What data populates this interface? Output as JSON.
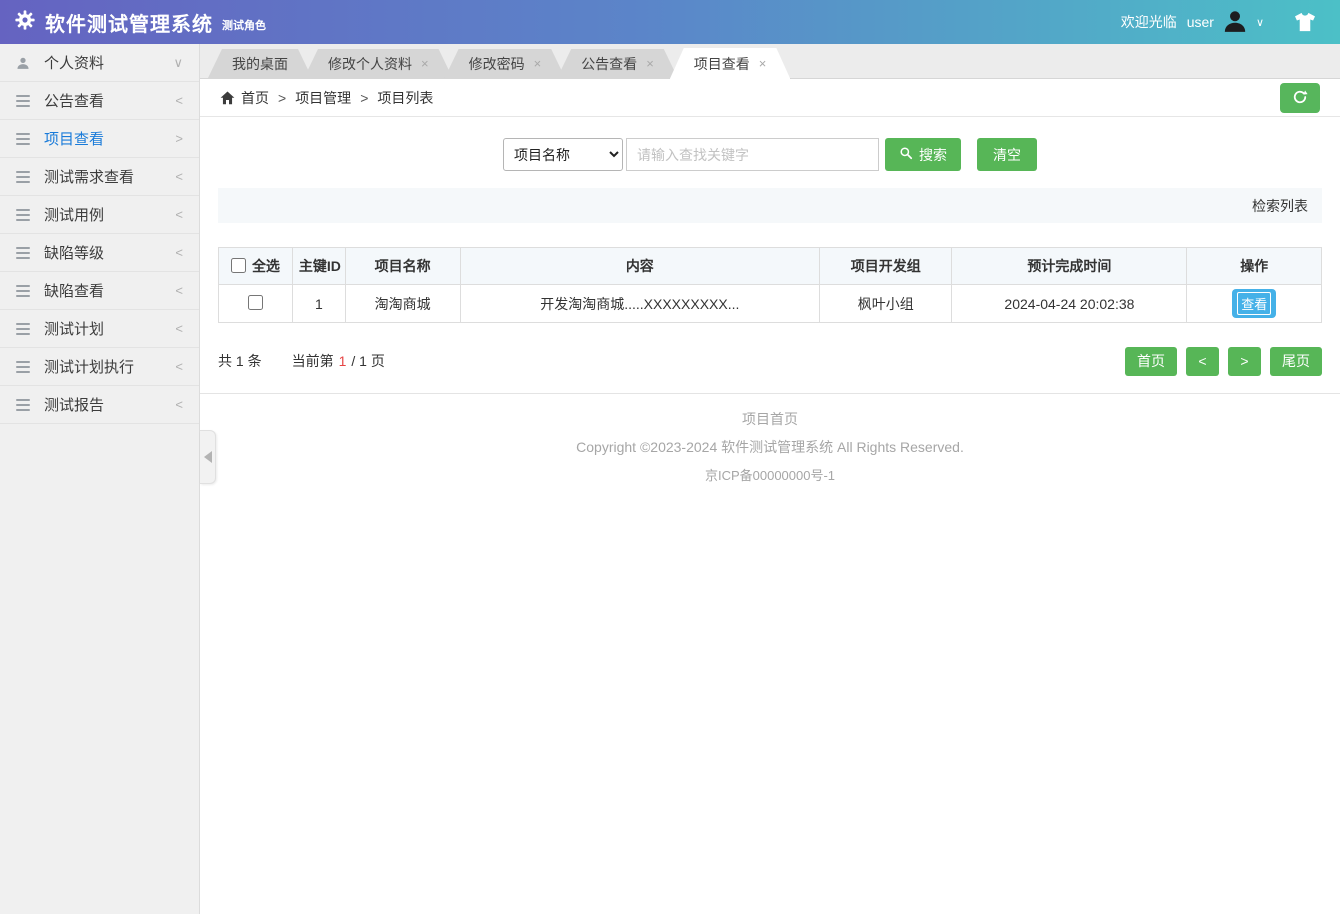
{
  "header": {
    "title": "软件测试管理系统",
    "subtitle": "测试角色",
    "welcome": "欢迎光临",
    "username": "user"
  },
  "icons": {
    "close": "×",
    "chevron_down": "∨",
    "chevron_left": "<",
    "chevron_right": ">"
  },
  "colors": {
    "header_gradient_left": "#6563c1",
    "header_gradient_right": "#4cc0c7",
    "accent_green": "#57b657",
    "action_blue": "#45b1e8",
    "active_menu_blue": "#1a7bd9",
    "page_number_red": "#e64545"
  },
  "sidebar": {
    "items": [
      {
        "name": "profile",
        "label": "个人资料",
        "icon": "user-icon",
        "arrow": "down",
        "active": false
      },
      {
        "name": "announcements",
        "label": "公告查看",
        "icon": "menu-icon",
        "arrow": "left",
        "active": false
      },
      {
        "name": "projects",
        "label": "项目查看",
        "icon": "menu-icon",
        "arrow": "right",
        "active": true
      },
      {
        "name": "test-requirements",
        "label": "测试需求查看",
        "icon": "menu-icon",
        "arrow": "left",
        "active": false
      },
      {
        "name": "test-cases",
        "label": "测试用例",
        "icon": "menu-icon",
        "arrow": "left",
        "active": false
      },
      {
        "name": "defect-levels",
        "label": "缺陷等级",
        "icon": "menu-icon",
        "arrow": "left",
        "active": false
      },
      {
        "name": "defects",
        "label": "缺陷查看",
        "icon": "menu-icon",
        "arrow": "left",
        "active": false
      },
      {
        "name": "test-plans",
        "label": "测试计划",
        "icon": "menu-icon",
        "arrow": "left",
        "active": false
      },
      {
        "name": "test-plan-execution",
        "label": "测试计划执行",
        "icon": "menu-icon",
        "arrow": "left",
        "active": false
      },
      {
        "name": "test-reports",
        "label": "测试报告",
        "icon": "menu-icon",
        "arrow": "left",
        "active": false
      }
    ]
  },
  "tabs": [
    {
      "name": "desktop",
      "label": "我的桌面",
      "closable": false,
      "active": false
    },
    {
      "name": "edit-profile",
      "label": "修改个人资料",
      "closable": true,
      "active": false
    },
    {
      "name": "change-password",
      "label": "修改密码",
      "closable": true,
      "active": false
    },
    {
      "name": "announcements",
      "label": "公告查看",
      "closable": true,
      "active": false
    },
    {
      "name": "projects",
      "label": "项目查看",
      "closable": true,
      "active": true
    }
  ],
  "breadcrumb": {
    "separator": ">",
    "items": [
      "首页",
      "项目管理",
      "项目列表"
    ]
  },
  "search": {
    "field_selected": "项目名称",
    "placeholder": "请输入查找关键字",
    "search_label": "搜索",
    "clear_label": "清空"
  },
  "list_bar": {
    "label": "检索列表"
  },
  "table": {
    "headers": [
      "全选",
      "主键ID",
      "项目名称",
      "内容",
      "项目开发组",
      "预计完成时间",
      "操作"
    ],
    "rows": [
      {
        "id": "1",
        "name": "淘淘商城",
        "content": "开发淘淘商城.....XXXXXXXXX...",
        "group": "枫叶小组",
        "due": "2024-04-24 20:02:38",
        "action": "查看"
      }
    ]
  },
  "pagination": {
    "total_text": "共 1 条",
    "current_label": "当前第",
    "current_page": "1",
    "page_total": "/ 1 页",
    "first": "首页",
    "prev": "<",
    "next": ">",
    "last": "尾页"
  },
  "footer": {
    "home_link": "项目首页",
    "copyright": "Copyright ©2023-2024 软件测试管理系统 All Rights Reserved.",
    "icp": "京ICP备00000000号-1"
  }
}
